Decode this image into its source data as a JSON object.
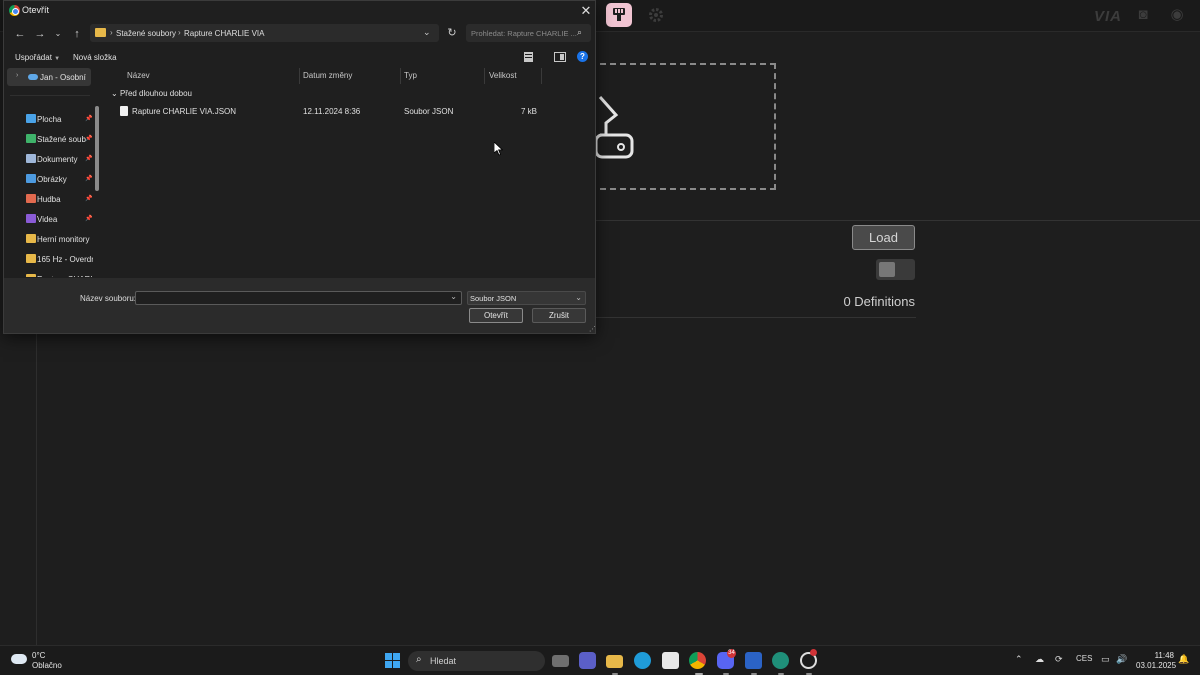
{
  "dialog": {
    "title": "Otevřít",
    "breadcrumb": [
      "Stažené soubory",
      "Rapture CHARLIE VIA"
    ],
    "search_placeholder": "Prohledat: Rapture CHARLIE ...",
    "commands": {
      "organize": "Uspořádat",
      "new_folder": "Nová složka"
    },
    "nav": {
      "onedrive": "Jan - Osobní",
      "items": [
        {
          "label": "Plocha",
          "icon": "desktop-icon",
          "color": "#4aa3e8",
          "pinned": true
        },
        {
          "label": "Stažené soub",
          "icon": "download-icon",
          "color": "#3fb36a",
          "pinned": true
        },
        {
          "label": "Dokumenty",
          "icon": "document-icon",
          "color": "#9fb7d9",
          "pinned": true
        },
        {
          "label": "Obrázky",
          "icon": "pictures-icon",
          "color": "#4d9be0",
          "pinned": true
        },
        {
          "label": "Hudba",
          "icon": "music-icon",
          "color": "#e26a4f",
          "pinned": true
        },
        {
          "label": "Videa",
          "icon": "video-icon",
          "color": "#8a5bd6",
          "pinned": true
        },
        {
          "label": "Herní monitory",
          "icon": "folder-icon",
          "color": "#e7b849",
          "pinned": false
        },
        {
          "label": "165 Hz - Overdr",
          "icon": "folder-icon",
          "color": "#e7b849",
          "pinned": false
        },
        {
          "label": "Rapture CHARLI",
          "icon": "folder-icon",
          "color": "#e7b849",
          "pinned": false
        }
      ]
    },
    "columns": {
      "name": "Název",
      "date": "Datum změny",
      "type": "Typ",
      "size": "Velikost"
    },
    "group": "Před dlouhou dobou",
    "files": [
      {
        "name": "Rapture CHARLIE VIA.JSON",
        "date": "12.11.2024 8:36",
        "type": "Soubor JSON",
        "size": "7 kB"
      }
    ],
    "filename_label": "Název souboru:",
    "filename_value": "",
    "filetype": "Soubor JSON",
    "open_button": "Otevřít",
    "cancel_button": "Zrušit"
  },
  "app": {
    "brand": "VIA",
    "load_button": "Load",
    "definitions": "0 Definitions",
    "accent": "#f1c4d2"
  },
  "taskbar": {
    "weather_temp": "0°C",
    "weather_desc": "Oblačno",
    "search_label": "Hledat",
    "discord_badge": "34",
    "language": "CES",
    "time": "11:48",
    "date": "03.01.2025"
  }
}
